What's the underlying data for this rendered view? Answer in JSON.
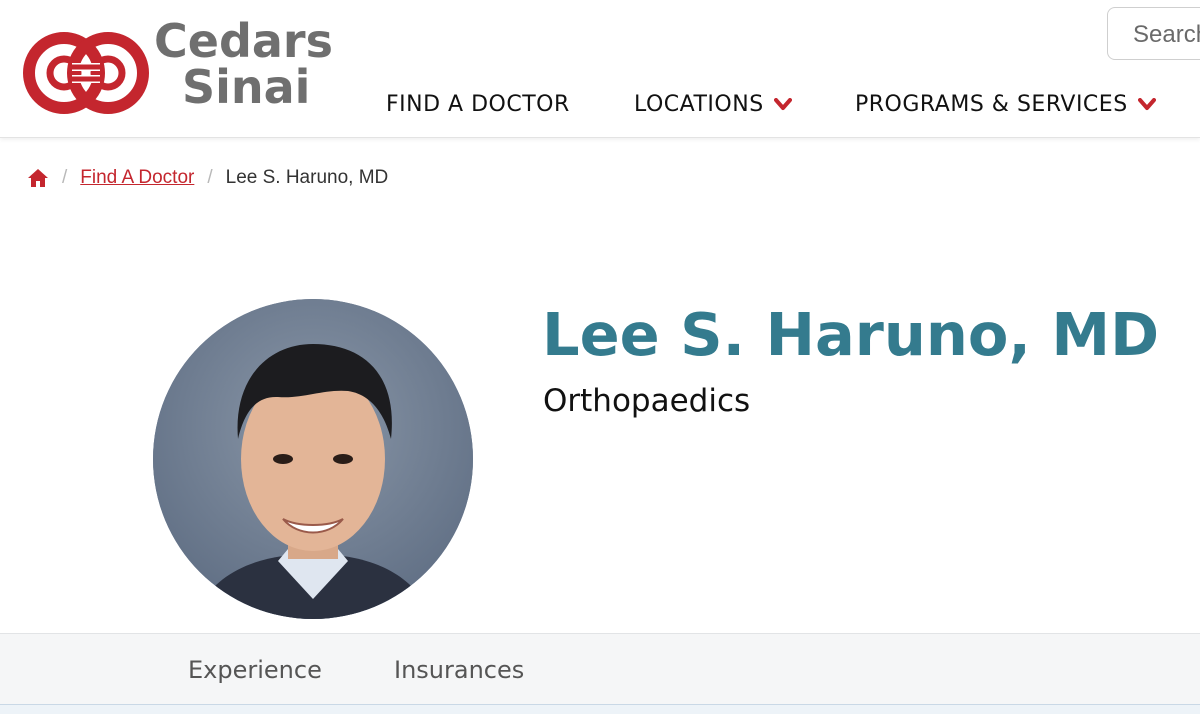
{
  "brand": {
    "name_line1": "Cedars",
    "name_line2": "Sinai",
    "logo_icon": "cedars-sinai-linked-rings-logo",
    "accent_color": "#c4262e",
    "logo_text_color": "#6f6f6f"
  },
  "search": {
    "placeholder": "Search",
    "icon": "search-field"
  },
  "nav": {
    "items": [
      {
        "label": "FIND A DOCTOR",
        "has_dropdown": false
      },
      {
        "label": "LOCATIONS",
        "has_dropdown": true,
        "icon": "chevron-down-icon"
      },
      {
        "label": "PROGRAMS & SERVICES",
        "has_dropdown": true,
        "icon": "chevron-down-icon"
      }
    ]
  },
  "breadcrumb": {
    "home_icon": "home-icon",
    "separator": "/",
    "link_label": "Find A Doctor",
    "current": "Lee S. Haruno, MD"
  },
  "profile": {
    "name": "Lee S. Haruno, MD",
    "specialty": "Orthopaedics",
    "name_color": "#347b8e",
    "photo": "doctor-portrait-photo"
  },
  "tabs": {
    "items": [
      {
        "label": "Experience"
      },
      {
        "label": "Insurances"
      }
    ]
  }
}
